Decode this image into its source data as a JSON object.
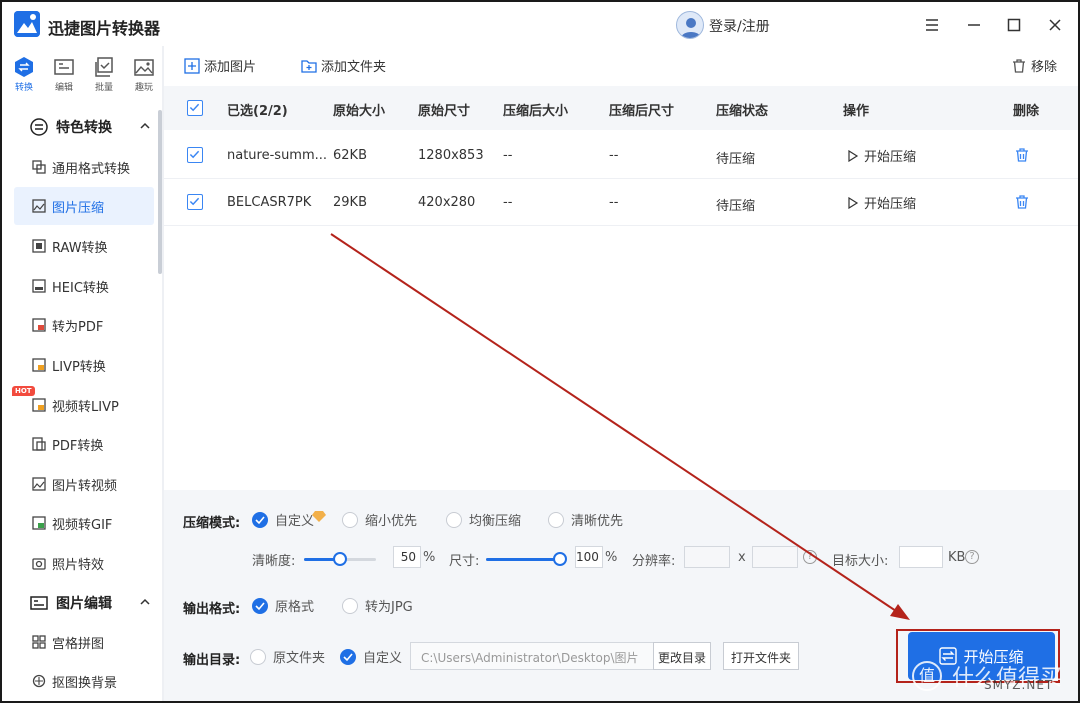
{
  "app": {
    "title": "迅捷图片转换器",
    "login": "登录/注册"
  },
  "icon_tabs": [
    {
      "label": "转换",
      "icon": "convert-icon",
      "active": true
    },
    {
      "label": "编辑",
      "icon": "edit-icon",
      "active": false
    },
    {
      "label": "批量",
      "icon": "batch-icon",
      "active": false
    },
    {
      "label": "趣玩",
      "icon": "fun-icon",
      "active": false
    }
  ],
  "sidebar": {
    "section1": "特色转换",
    "section2": "图片编辑",
    "hot": "HOT",
    "items": [
      "通用格式转换",
      "图片压缩",
      "RAW转换",
      "HEIC转换",
      "转为PDF",
      "LIVP转换",
      "视频转LIVP",
      "PDF转换",
      "图片转视频",
      "视频转GIF",
      "照片特效"
    ],
    "items2": [
      "宫格拼图",
      "抠图换背景"
    ]
  },
  "toolbar": {
    "add_image": "添加图片",
    "add_folder": "添加文件夹",
    "remove": "移除"
  },
  "table": {
    "headers": {
      "selected": "已选(2/2)",
      "orig_size": "原始大小",
      "orig_dim": "原始尺寸",
      "comp_size": "压缩后大小",
      "comp_dim": "压缩后尺寸",
      "status": "压缩状态",
      "action": "操作",
      "delete": "删除"
    },
    "rows": [
      {
        "name": "nature-summ...",
        "size": "62KB",
        "dim": "1280x853",
        "csize": "--",
        "cdim": "--",
        "status": "待压缩",
        "action": "开始压缩"
      },
      {
        "name": "BELCASR7PK",
        "size": "29KB",
        "dim": "420x280",
        "csize": "--",
        "cdim": "--",
        "status": "待压缩",
        "action": "开始压缩"
      }
    ]
  },
  "settings": {
    "mode_label": "压缩模式:",
    "modes": [
      "自定义",
      "缩小优先",
      "均衡压缩",
      "清晰优先"
    ],
    "clarity_label": "清晰度:",
    "clarity_value": "50",
    "clarity_pct": 0.5,
    "size_label": "尺寸:",
    "size_value": "100",
    "size_pct": 1.0,
    "percent": "%",
    "resolution_label": "分辨率:",
    "x": "x",
    "target_label": "目标大小:",
    "kb": "KB",
    "output_format_label": "输出格式:",
    "formats": [
      "原格式",
      "转为JPG"
    ],
    "output_dir_label": "输出目录:",
    "dirs": [
      "原文件夹",
      "自定义"
    ],
    "path": "C:\\Users\\Administrator\\Desktop\\图片",
    "change_dir": "更改目录",
    "open_folder": "打开文件夹",
    "start": "开始压缩"
  },
  "watermark": {
    "logo": "值",
    "text": "什么值得买",
    "sub": "SMYZ.NET"
  },
  "colors": {
    "accent": "#1f6fe5",
    "annotation": "#b4231b"
  }
}
